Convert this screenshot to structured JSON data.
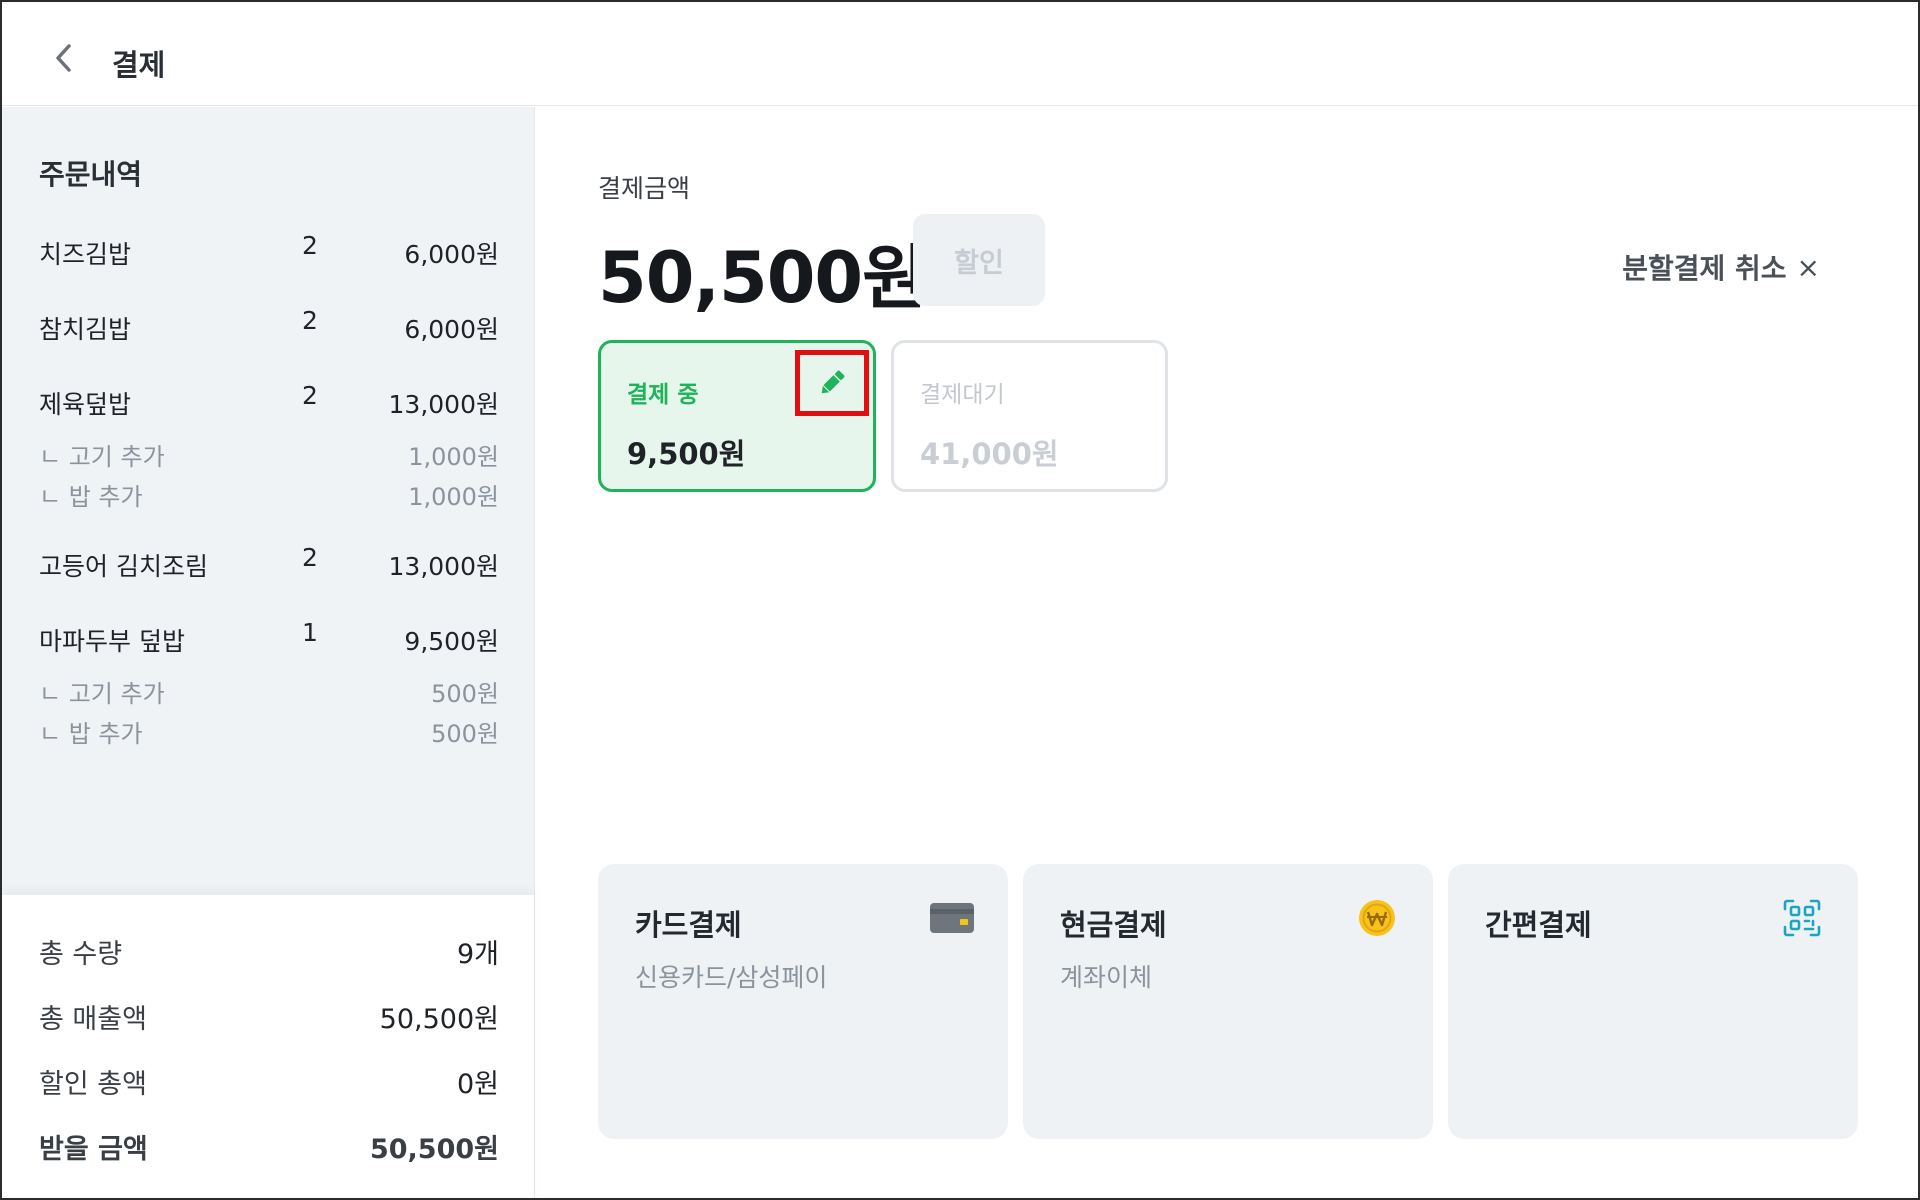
{
  "header": {
    "title": "결제"
  },
  "sidebar": {
    "title": "주문내역",
    "items": [
      {
        "name": "치즈김밥",
        "qty": "2",
        "price": "6,000원",
        "options": []
      },
      {
        "name": "참치김밥",
        "qty": "2",
        "price": "6,000원",
        "options": []
      },
      {
        "name": "제육덮밥",
        "qty": "2",
        "price": "13,000원",
        "options": [
          {
            "name": "ㄴ 고기 추가",
            "price": "1,000원"
          },
          {
            "name": "ㄴ 밥 추가",
            "price": "1,000원"
          }
        ]
      },
      {
        "name": "고등어 김치조림",
        "qty": "2",
        "price": "13,000원",
        "options": []
      },
      {
        "name": "마파두부 덮밥",
        "qty": "1",
        "price": "9,500원",
        "options": [
          {
            "name": "ㄴ 고기 추가",
            "price": "500원"
          },
          {
            "name": "ㄴ 밥 추가",
            "price": "500원"
          }
        ]
      }
    ],
    "summary": {
      "total_qty_label": "총 수량",
      "total_qty": "9개",
      "total_sales_label": "총 매출액",
      "total_sales": "50,500원",
      "discount_total_label": "할인 총액",
      "discount_total": "0원",
      "receivable_label": "받을 금액",
      "receivable": "50,500원"
    }
  },
  "main": {
    "amount_label": "결제금액",
    "amount": "50,500원",
    "discount_button": "할인",
    "split_cancel": "분할결제 취소",
    "split_cancel_icon": "×",
    "in_progress": {
      "status": "결제 중",
      "amount": "9,500원"
    },
    "pending": {
      "status": "결제대기",
      "amount": "41,000원"
    },
    "methods": [
      {
        "title": "카드결제",
        "sub": "신용카드/삼성페이",
        "icon": "credit-card-icon"
      },
      {
        "title": "현금결제",
        "sub": "계좌이체",
        "icon": "won-coin-icon"
      },
      {
        "title": "간편결제",
        "sub": "",
        "icon": "qr-code-icon"
      }
    ]
  },
  "colors": {
    "accent": "#1fb35a",
    "highlight": "#e00f0f",
    "sidebar_bg": "#f0f3f6"
  }
}
